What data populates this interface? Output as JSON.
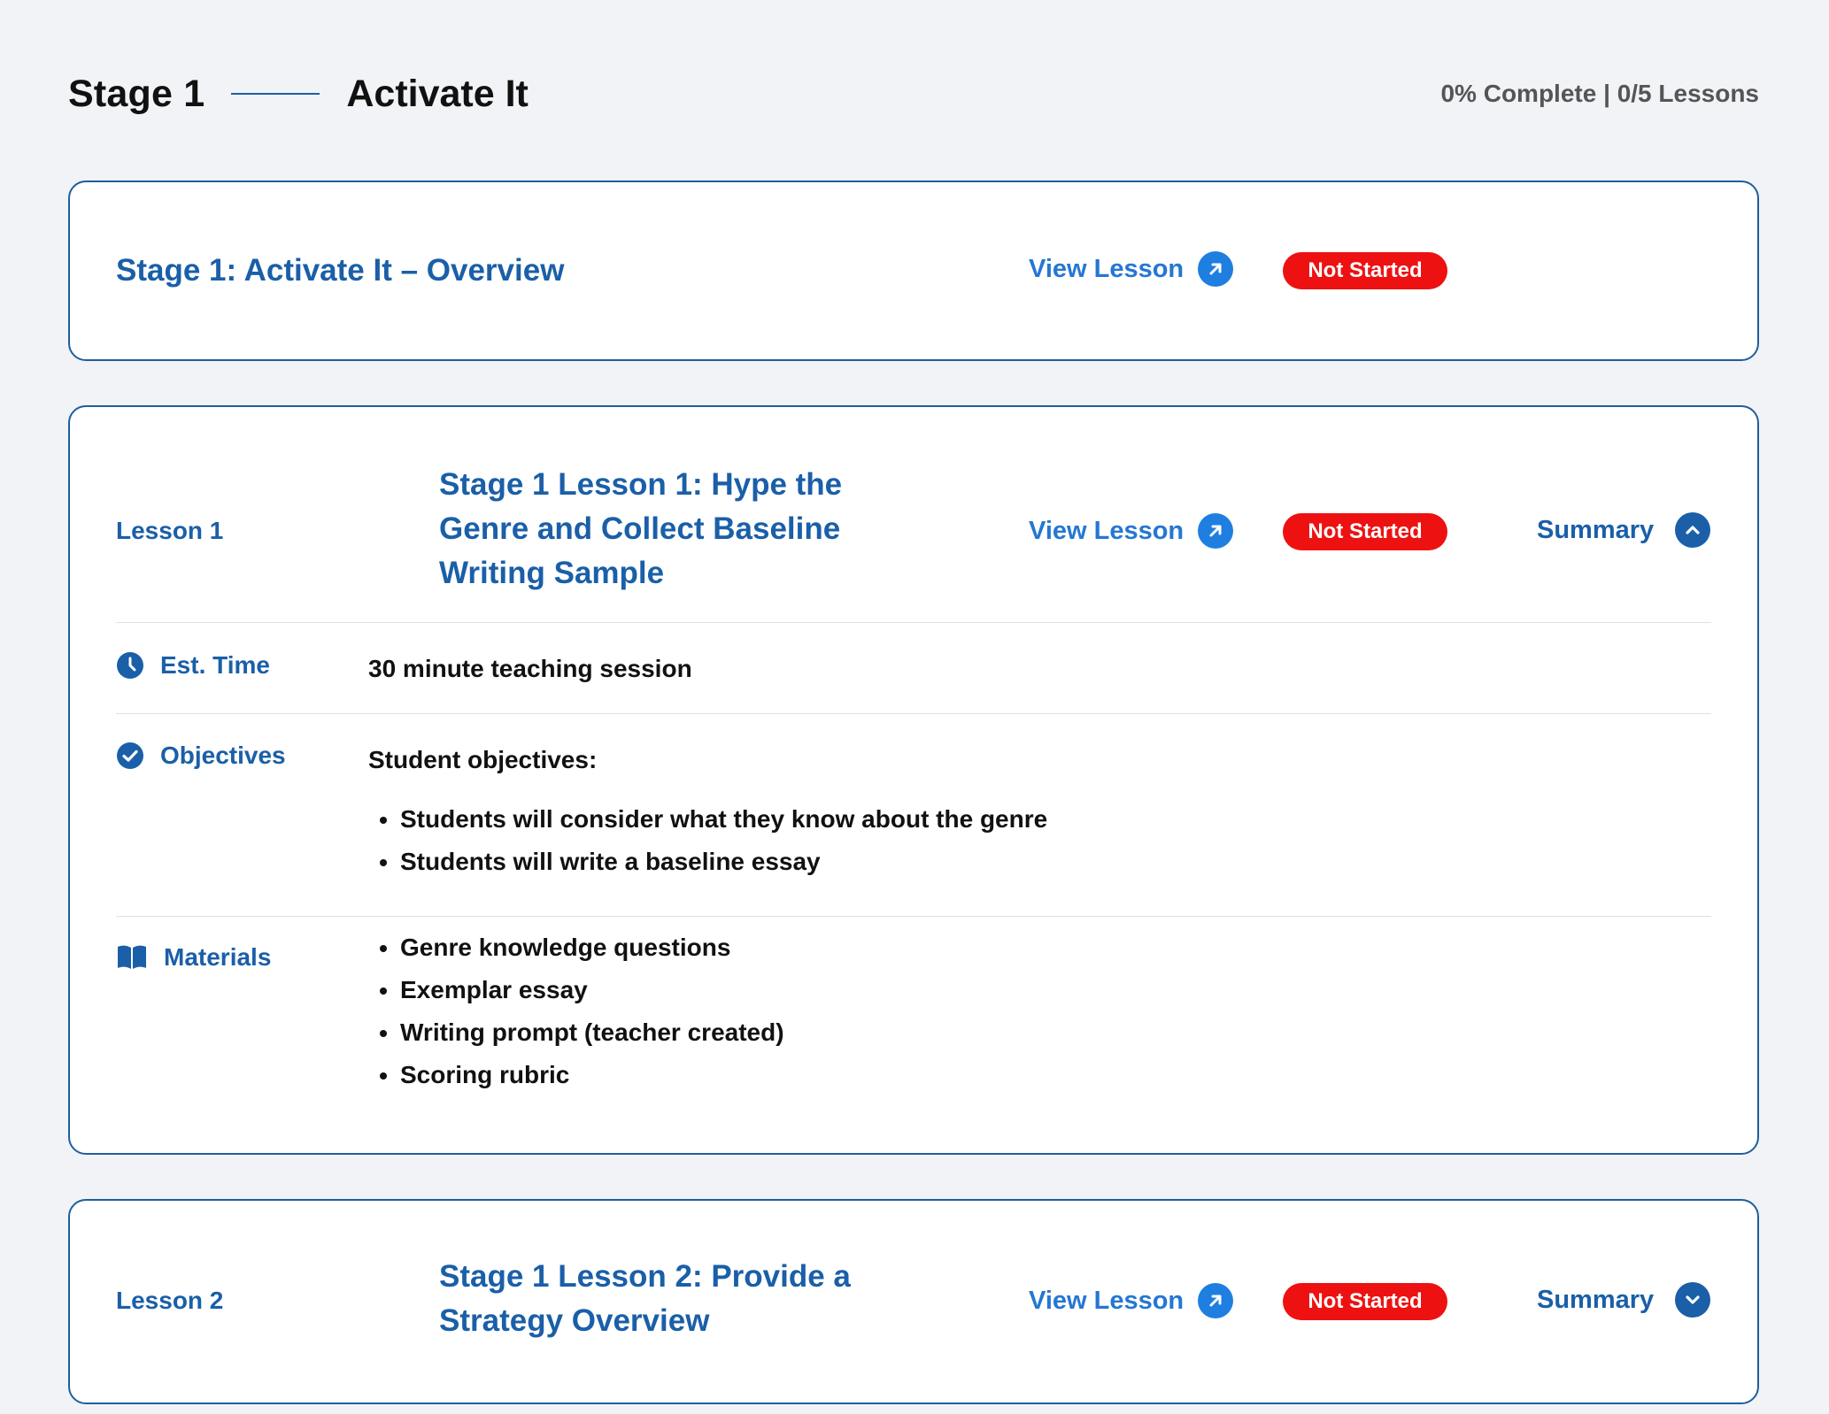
{
  "header": {
    "stage_number": "Stage 1",
    "stage_name": "Activate It",
    "progress": "0% Complete | 0/5 Lessons"
  },
  "overview": {
    "title": "Stage 1: Activate It – Overview",
    "view_lesson": "View Lesson",
    "status": "Not Started"
  },
  "lesson1": {
    "label": "Lesson 1",
    "title": "Stage 1 Lesson 1: Hype the Genre and Collect Baseline Writing Sample",
    "view_lesson": "View Lesson",
    "status": "Not Started",
    "summary": "Summary",
    "summary_state": "expanded",
    "est_time_label": "Est. Time",
    "est_time_value": "30 minute teaching session",
    "objectives_label": "Objectives",
    "objectives_intro": "Student objectives:",
    "objectives": [
      "Students will consider what they know about the genre",
      "Students will write a baseline essay"
    ],
    "materials_label": "Materials",
    "materials": [
      "Genre knowledge questions",
      "Exemplar essay",
      "Writing prompt (teacher created)",
      "Scoring rubric"
    ]
  },
  "lesson2": {
    "label": "Lesson 2",
    "title": "Stage 1 Lesson 2: Provide a Strategy Overview",
    "view_lesson": "View Lesson",
    "status": "Not Started",
    "summary": "Summary",
    "summary_state": "collapsed"
  },
  "colors": {
    "primary_blue": "#1a5fa8",
    "link_blue": "#2577d2",
    "status_red": "#ee1111",
    "background": "#f1f3f6"
  },
  "icons": {
    "view_lesson": "arrow-up-right-icon",
    "expanded": "chevron-up-icon",
    "collapsed": "chevron-down-icon",
    "est_time": "clock-icon",
    "objectives": "check-circle-icon",
    "materials": "book-icon"
  }
}
